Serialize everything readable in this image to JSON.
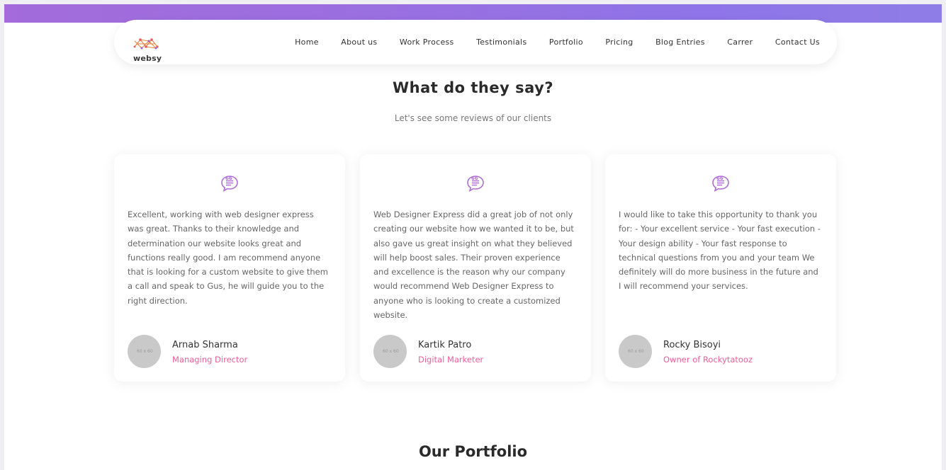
{
  "brand": {
    "logo_text": "websy"
  },
  "nav": {
    "items": [
      {
        "label": "Home"
      },
      {
        "label": "About us"
      },
      {
        "label": "Work Process"
      },
      {
        "label": "Testimonials"
      },
      {
        "label": "Portfolio"
      },
      {
        "label": "Pricing"
      },
      {
        "label": "Blog Entries"
      },
      {
        "label": "Carrer"
      },
      {
        "label": "Contact Us"
      }
    ]
  },
  "testimonials": {
    "title": "What do they say?",
    "subtitle": "Let's see some reviews of our clients",
    "cards": [
      {
        "text": "Excellent, working with web designer express was great. Thanks to their knowledge and determination our website looks great and functions really good. I am recommend anyone that is looking for a custom website to give them a call and speak to Gus, he will guide you to the right direction.",
        "name": "Arnab Sharma",
        "role": "Managing Director",
        "avatar_text": "60 x 60"
      },
      {
        "text": "Web Designer Express did a great job of not only creating our website how we wanted it to be, but also gave us great insight on what they believed will help boost sales. Their proven experience and excellence is the reason why our company would recommend Web Designer Express to anyone who is looking to create a customized website.",
        "name": "Kartik Patro",
        "role": "Digital Marketer",
        "avatar_text": "60 x 60"
      },
      {
        "text": "I would like to take this opportunity to thank you for: - Your excellent service - Your fast execution - Your design ability - Your fast response to technical questions from you and your team We definitely will do more business in the future and I will recommend your services.",
        "name": "Rocky Bisoyi",
        "role": "Owner of Rockytatooz",
        "avatar_text": "60 x 60"
      }
    ]
  },
  "portfolio": {
    "title": "Our Portfolio"
  },
  "colors": {
    "accent": "#ef5d98",
    "band": "#9a6fe0",
    "icon": "#b06fd8"
  }
}
